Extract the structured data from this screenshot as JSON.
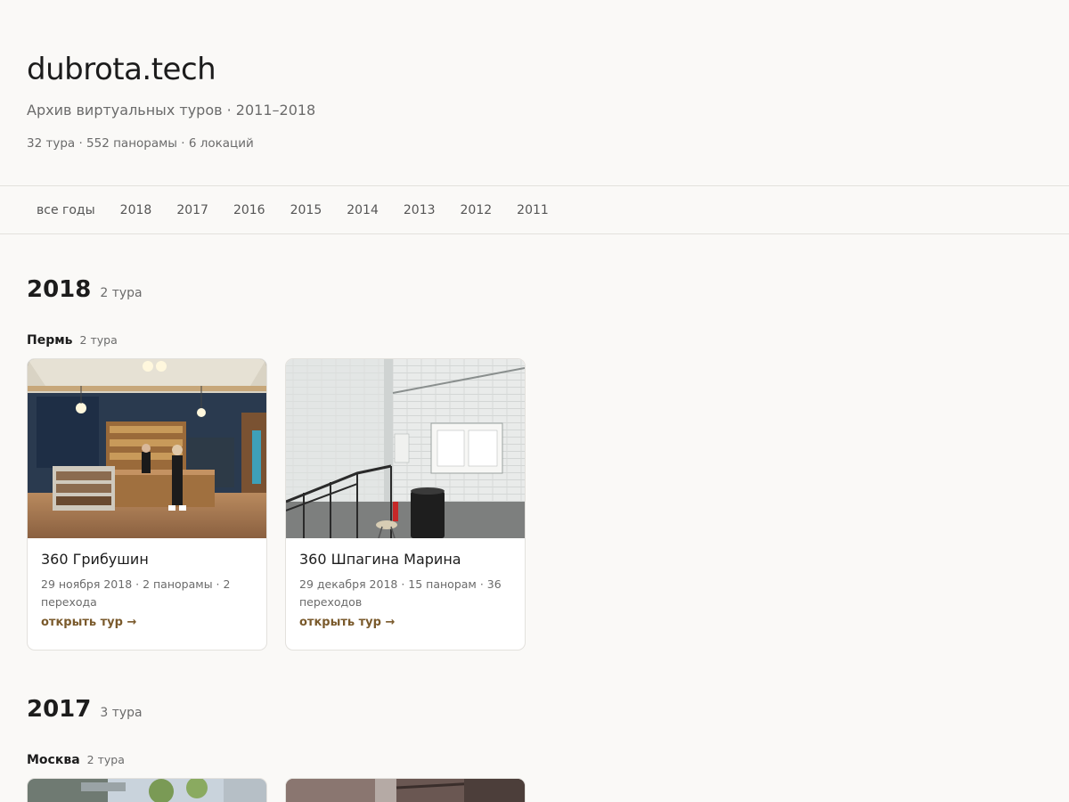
{
  "site": {
    "title": "dubrota.tech",
    "subtitle": "Архив виртуальных туров · 2011–2018",
    "stats": "32 тура · 552 панорамы · 6 локаций"
  },
  "nav": {
    "items": [
      "все годы",
      "2018",
      "2017",
      "2016",
      "2015",
      "2014",
      "2013",
      "2012",
      "2011"
    ]
  },
  "sections": [
    {
      "year": "2018",
      "count": "2 тура",
      "location": {
        "name": "Пермь",
        "count": "2 тура"
      },
      "cards": [
        {
          "title": "360 Грибушин",
          "meta": "29 ноября 2018 · 2 панорамы · 2 перехода",
          "link": "открыть тур →",
          "image": "cafe-interior-panorama"
        },
        {
          "title": "360 Шпагина Марина",
          "meta": "29 декабря 2018 · 15 панорам · 36 переходов",
          "link": "открыть тур →",
          "image": "white-brick-wall-stairs-panorama"
        }
      ]
    },
    {
      "year": "2017",
      "count": "3 тура",
      "location": {
        "name": "Москва",
        "count": "2 тура"
      },
      "cards": [
        {
          "image": "street-panorama"
        },
        {
          "image": "interior-panorama"
        }
      ]
    }
  ],
  "colors": {
    "background": "#faf9f7",
    "accent_link": "#7a5a2c",
    "border": "#e3e1dd"
  }
}
